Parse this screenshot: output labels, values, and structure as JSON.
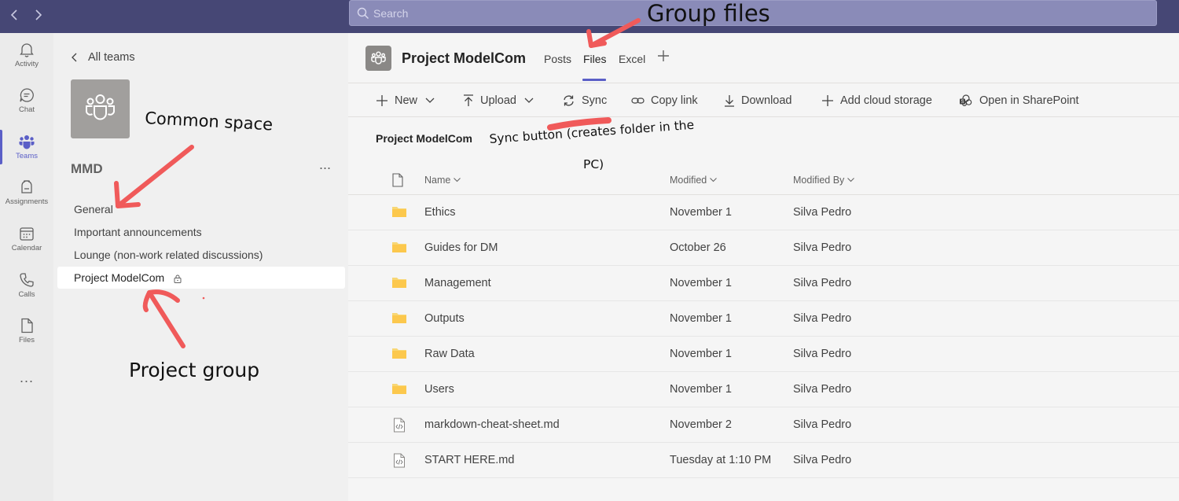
{
  "search": {
    "placeholder": "Search"
  },
  "rail": [
    {
      "label": "Activity",
      "icon": "bell-icon"
    },
    {
      "label": "Chat",
      "icon": "chat-icon"
    },
    {
      "label": "Teams",
      "icon": "teams-icon",
      "active": true
    },
    {
      "label": "Assignments",
      "icon": "assignments-icon"
    },
    {
      "label": "Calendar",
      "icon": "calendar-icon"
    },
    {
      "label": "Calls",
      "icon": "phone-icon"
    },
    {
      "label": "Files",
      "icon": "file-icon"
    }
  ],
  "rail_more": "...",
  "team": {
    "back_label": "All teams",
    "name": "MMD",
    "more": "...",
    "channels": [
      {
        "label": "General"
      },
      {
        "label": "Important announcements"
      },
      {
        "label": "Lounge (non-work related discussions)"
      },
      {
        "label": "Project ModelCom",
        "selected": true,
        "private": true
      }
    ]
  },
  "header": {
    "title": "Project ModelCom",
    "tabs": [
      {
        "label": "Posts"
      },
      {
        "label": "Files",
        "active": true
      },
      {
        "label": "Excel"
      }
    ]
  },
  "toolbar": {
    "new": "New",
    "upload": "Upload",
    "sync": "Sync",
    "copy_link": "Copy link",
    "download": "Download",
    "add_cloud": "Add cloud storage",
    "open_sharepoint": "Open in SharePoint"
  },
  "breadcrumb": "Project ModelCom",
  "table": {
    "columns": [
      "Name",
      "Modified",
      "Modified By"
    ],
    "rows": [
      {
        "type": "folder",
        "name": "Ethics",
        "modified": "November 1",
        "by": "Silva Pedro"
      },
      {
        "type": "folder",
        "name": "Guides for DM",
        "modified": "October 26",
        "by": "Silva Pedro"
      },
      {
        "type": "folder",
        "name": "Management",
        "modified": "November 1",
        "by": "Silva Pedro"
      },
      {
        "type": "folder",
        "name": "Outputs",
        "modified": "November 1",
        "by": "Silva Pedro"
      },
      {
        "type": "folder",
        "name": "Raw Data",
        "modified": "November 1",
        "by": "Silva Pedro"
      },
      {
        "type": "folder",
        "name": "Users",
        "modified": "November 1",
        "by": "Silva Pedro"
      },
      {
        "type": "code-file",
        "name": "markdown-cheat-sheet.md",
        "modified": "November 2",
        "by": "Silva Pedro"
      },
      {
        "type": "code-file",
        "name": "START HERE.md",
        "modified": "Tuesday at 1:10 PM",
        "by": "Silva Pedro"
      }
    ]
  },
  "annotations": {
    "group_files": "Group files",
    "common_space": "Common space",
    "project_group": "Project group",
    "sync_line1": "Sync button (creates folder in the",
    "sync_line2": "PC)"
  },
  "colors": {
    "topbar": "#464775",
    "accent": "#5b5fc7",
    "folder": "#f8d775",
    "annotation": "#f05a5a"
  }
}
